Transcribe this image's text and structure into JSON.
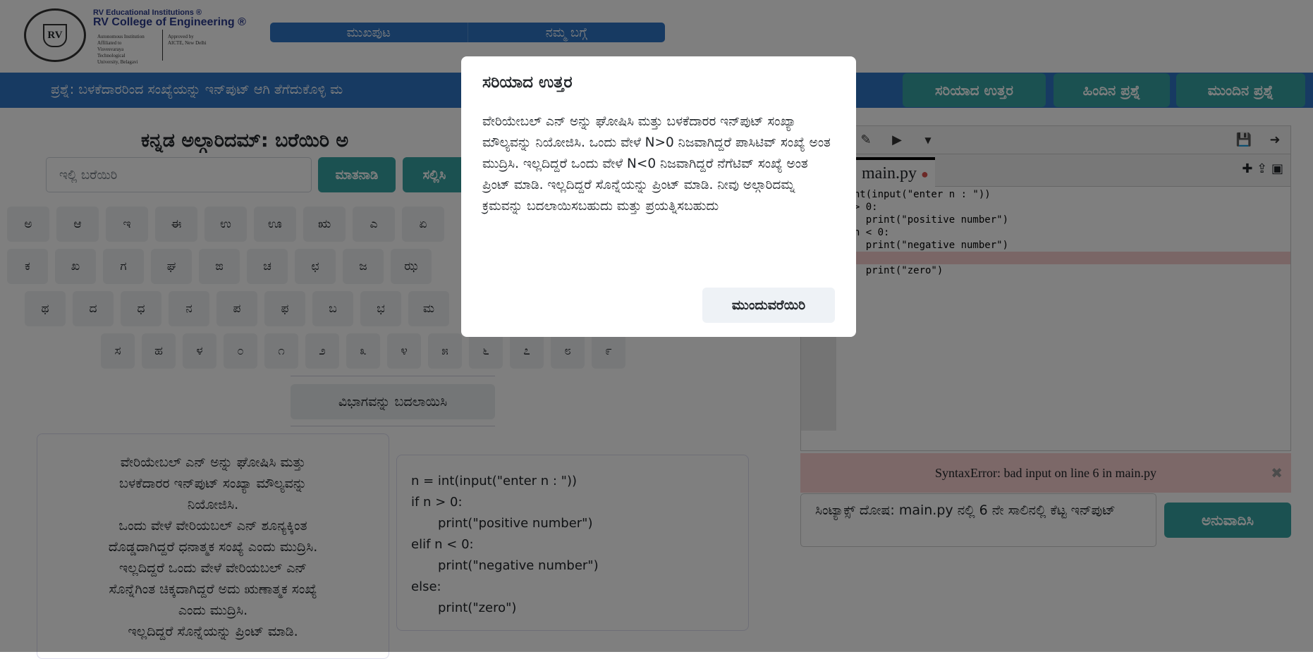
{
  "logo": {
    "line1": "RV Educational Institutions ®",
    "line2": "RV College of Engineering ®",
    "affiliation": "Autonomous Institution Affiliated to Visvesvaraya Technological University, Belagavi",
    "approval": "Approved by AICTE, New Delhi",
    "seal": "RV"
  },
  "nav": [
    "ಮುಖಪುಟ",
    "ನಮ್ಮ ಬಗ್ಗೆ"
  ],
  "question": "ಪ್ರಶ್ನೆ: ಬಳಕೆದಾರರಿಂದ ಸಂಖ್ಯೆಯನ್ನು ಇನ್‌ಪುಟ್ ಆಗಿ ತೆಗೆದುಕೊಳ್ಳಿ ಮ",
  "top_buttons": {
    "answer": "ಸರಿಯಾದ ಉತ್ತರ",
    "prev": "ಹಿಂದಿನ ಪ್ರಶ್ನೆ",
    "next": "ಮುಂದಿನ ಪ್ರಶ್ನೆ"
  },
  "title": "ಕನ್ನಡ ಅಲ್ಗಾರಿದಮ್: ಬರೆಯಿರಿ ಅ",
  "input_placeholder": "ಇಲ್ಲಿ ಬರೆಯಿರಿ",
  "speak": "ಮಾತನಾಡಿ",
  "submit": "ಸಲ್ಲಿಸಿ",
  "keyboard": [
    [
      "ಅ",
      "ಆ",
      "ಇ",
      "ಈ",
      "ಉ",
      "ಊ",
      "ಋ",
      "ಎ",
      "ಏ"
    ],
    [
      "ಕ",
      "ಖ",
      "ಗ",
      "ಘ",
      "ಙ",
      "ಚ",
      "ಛ",
      "ಜ",
      "ಝ"
    ],
    [
      "ಥ",
      "ದ",
      "ಧ",
      "ನ",
      "ಪ",
      "ಫ",
      "ಬ",
      "ಭ",
      "ಮ"
    ],
    [
      "ಸ",
      "ಹ",
      "ಳ",
      "೦",
      "೧",
      "೨",
      "೩",
      "೪",
      "೫",
      "೬",
      "೭",
      "೮",
      "೯"
    ]
  ],
  "change_section": "ವಿಭಾಗವನ್ನು ಬದಲಾಯಿಸಿ",
  "description": [
    "ವೇರಿಯೇಬಲ್ ಎನ್ ಅನ್ನು ಘೋಷಿಸಿ ಮತ್ತು",
    "ಬಳಕೆದಾರರ ಇನ್‌ಪುಟ್ ಸಂಖ್ಯಾ ಮೌಲ್ಯವನ್ನು",
    "ನಿಯೋಜಿಸಿ.",
    "ಒಂದು ವೇಳೆ ವೇರಿಯಬಲ್ ಎನ್ ಶೂನ್ಯಕ್ಕಿಂತ",
    "ದೊಡ್ಡದಾಗಿದ್ದರೆ ಧನಾತ್ಮಕ ಸಂಖ್ಯೆ ಎಂದು ಮುದ್ರಿಸಿ.",
    "ಇಲ್ಲದಿದ್ದರೆ ಒಂದು ವೇಳೆ ವೇರಿಯಬಲ್ ಎನ್",
    "ಸೊನ್ನೆಗಿಂತ ಚಿಕ್ಕದಾಗಿದ್ದರೆ ಅದು ಋಣಾತ್ಮಕ ಸಂಖ್ಯೆ",
    "ಎಂದು ಮುದ್ರಿಸಿ.",
    "ಇಲ್ಲದಿದ್ದರೆ ಸೊನ್ನೆಯನ್ನು ಪ್ರಿಂಟ್ ಮಾಡಿ."
  ],
  "code_card": [
    "n = int(input(\"enter n : \"))",
    "if n > 0:",
    "print(\"positive number\")",
    "elif n < 0:",
    "print(\"negative number\")",
    "else:",
    "print(\"zero\")"
  ],
  "editor": {
    "file": "main.py",
    "lines": [
      " int(input(\"enter n : \"))",
      "n > 0:",
      "    print(\"positive number\")",
      "f n < 0:",
      "    print(\"negative number\")",
      "e",
      "    print(\"zero\")"
    ],
    "error_line": 6
  },
  "error": "SyntaxError: bad input on line 6 in main.py",
  "translation": "ಸಿಂಟ್ಯಾಕ್ಸ್ ದೋಷ: main.py ನಲ್ಲಿ 6 ನೇ ಸಾಲಿನಲ್ಲಿ ಕೆಟ್ಟ ಇನ್‌ಪುಟ್",
  "translate": "ಅನುವಾದಿಸಿ",
  "modal": {
    "title": "ಸರಿಯಾದ ಉತ್ತರ",
    "body": "ವೇರಿಯೇಬಲ್ ಎನ್ ಅನ್ನು ಘೋಷಿಸಿ ಮತ್ತು ಬಳಕೆದಾರರ ಇನ್‌ಪುಟ್ ಸಂಖ್ಯಾ ಮೌಲ್ಯವನ್ನು ನಿಯೋಜಿಸಿ. ಒಂದು ವೇಳೆ N>0 ನಿಜವಾಗಿದ್ದರೆ ಪಾಸಿಟಿವ್ ಸಂಖ್ಯೆ ಅಂತ ಮುದ್ರಿಸಿ. ಇಲ್ಲದಿದ್ದರೆ ಒಂದು ವೇಳೆ N<0 ನಿಜವಾಗಿದ್ದರೆ ನೆಗೆಟಿವ್ ಸಂಖ್ಯೆ ಅಂತ ಪ್ರಿಂಟ್ ಮಾಡಿ. ಇಲ್ಲದಿದ್ದರೆ ಸೊನ್ನೆಯನ್ನು ಪ್ರಿಂಟ್ ಮಾಡಿ. ನೀವು ಅಲ್ಗಾರಿದಮ್ನ ಕ್ರಮವನ್ನು ಬದಲಾಯಿಸಬಹುದು ಮತ್ತು ಪ್ರಯತ್ನಿಸಬಹುದು",
    "continue": "ಮುಂದುವರೆಯಿರಿ"
  }
}
